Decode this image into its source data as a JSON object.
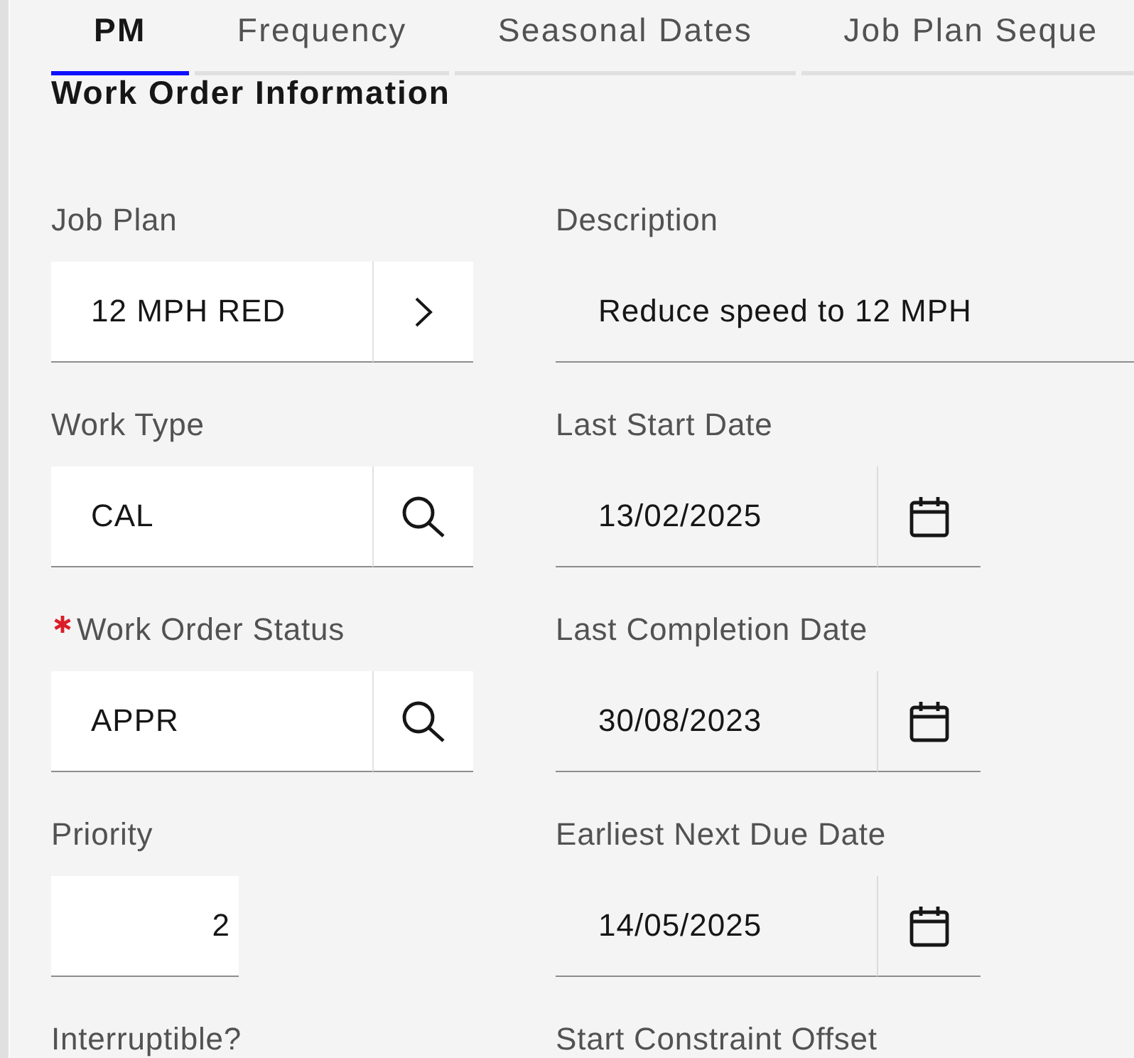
{
  "tabs": [
    {
      "label": "PM",
      "selected": true
    },
    {
      "label": "Frequency",
      "selected": false
    },
    {
      "label": "Seasonal Dates",
      "selected": false
    },
    {
      "label": "Job Plan Seque",
      "selected": false
    }
  ],
  "section": {
    "title": "Work Order Information"
  },
  "fields": [
    {
      "kind": "drilldown",
      "label": "Job Plan",
      "value": "12 MPH RED",
      "required": false
    },
    {
      "kind": "text",
      "label": "Description",
      "value": "Reduce speed to 12 MPH",
      "required": false
    },
    {
      "kind": "lookup",
      "label": "Work Type",
      "value": "CAL",
      "required": false
    },
    {
      "kind": "date",
      "label": "Last Start Date",
      "value": "13/02/2025",
      "required": false
    },
    {
      "kind": "lookup",
      "label": "Work Order Status",
      "value": "APPR",
      "required": true
    },
    {
      "kind": "date",
      "label": "Last Completion Date",
      "value": "30/08/2023",
      "required": false
    },
    {
      "kind": "number",
      "label": "Priority",
      "value": "2",
      "required": false
    },
    {
      "kind": "date",
      "label": "Earliest Next Due Date",
      "value": "14/05/2025",
      "required": false
    },
    {
      "kind": "label",
      "label": "Interruptible?",
      "required": false
    },
    {
      "kind": "label",
      "label": "Start Constraint Offset",
      "required": false
    }
  ]
}
